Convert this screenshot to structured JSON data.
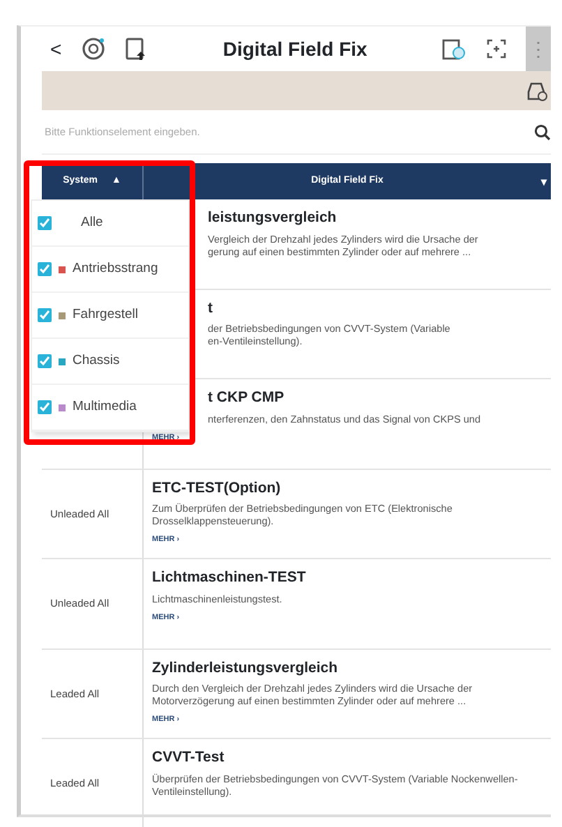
{
  "topbar": {
    "back": "<",
    "title": "Digital Field Fix",
    "more": "⋮"
  },
  "search": {
    "placeholder": "Bitte Funktionselement eingeben."
  },
  "table": {
    "columns": [
      {
        "label": "System",
        "sort": "▲"
      },
      {
        "label": "Digital Field Fix",
        "sort": "▾"
      }
    ],
    "rows": [
      {
        "covered": true,
        "system": "",
        "title": "leistungsvergleich",
        "description": "Vergleich der Drehzahl jedes Zylinders wird die Ursache der\ngerung auf einen bestimmten Zylinder oder auf mehrere ...",
        "more": ""
      },
      {
        "covered": true,
        "system": "",
        "title": "t",
        "description": "der Betriebsbedingungen von CVVT-System (Variable\nen-Ventileinstellung).",
        "more": ""
      },
      {
        "covered": true,
        "system": "",
        "title": "t CKP CMP",
        "description": "nterferenzen, den Zahnstatus und das Signal von CKPS und",
        "more": "MEHR ›"
      },
      {
        "covered": false,
        "system": "Unleaded All",
        "title": "ETC-TEST(Option)",
        "description": "Zum Überprüfen der Betriebsbedingungen von ETC (Elektronische Drosselklappensteuerung).",
        "more": "MEHR ›"
      },
      {
        "covered": false,
        "system": "Unleaded All",
        "title": "Lichtmaschinen-TEST",
        "description": "Lichtmaschinenleistungstest.",
        "more": "MEHR ›"
      },
      {
        "covered": false,
        "system": "Leaded All",
        "title": "Zylinderleistungsvergleich",
        "description": "Durch den Vergleich der Drehzahl jedes Zylinders wird die Ursache der Motorverzögerung auf einen bestimmten Zylinder oder auf mehrere ...",
        "more": "MEHR ›"
      },
      {
        "covered": false,
        "system": "Leaded All",
        "title": "CVVT-Test",
        "description": "Überprüfen der Betriebsbedingungen von CVVT-System (Variable Nockenwellen-Ventileinstellung).",
        "more": ""
      }
    ]
  },
  "filter_menu": {
    "items": [
      {
        "label": "Alle",
        "checked": true
      },
      {
        "label": "Antriebsstrang",
        "checked": true,
        "color": "#d9534f"
      },
      {
        "label": "Fahrgestell",
        "checked": true,
        "color": "#a89a78"
      },
      {
        "label": "Chassis",
        "checked": true,
        "color": "#2aa7c0"
      },
      {
        "label": "Multimedia",
        "checked": true,
        "color": "#b98ac9"
      }
    ]
  }
}
